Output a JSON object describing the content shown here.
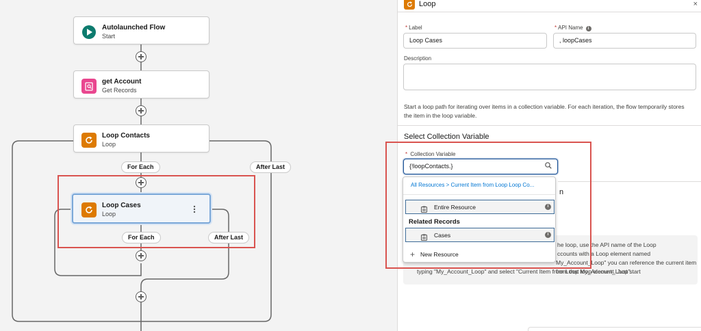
{
  "canvas": {
    "nodes": [
      {
        "title": "Autolaunched Flow",
        "subtitle": "Start"
      },
      {
        "title": "get Account",
        "subtitle": "Get Records"
      },
      {
        "title": "Loop Contacts",
        "subtitle": "Loop"
      },
      {
        "title": "Loop Cases",
        "subtitle": "Loop"
      }
    ],
    "outer_for_each": "For Each",
    "outer_after_last": "After Last",
    "inner_for_each": "For Each",
    "inner_after_last": "After Last"
  },
  "panel": {
    "title": "Loop",
    "close_glyph": "×",
    "label_field": {
      "label": "Label",
      "value": "Loop Cases"
    },
    "api_name_field": {
      "label": "API Name",
      "value": ", loopCases"
    },
    "description_field": {
      "label": "Description",
      "value": ""
    },
    "intro_text": "Start a loop path for iterating over items in a collection variable. For each iteration, the flow temporarily stores the item in the loop variable.",
    "section_title": "Select Collection Variable",
    "collection_field": {
      "label": "Collection Variable",
      "value": "{!loopContacts.}"
    },
    "hidden_heading_fragment": "n",
    "info_line1": "he loop, use the API name of the Loop",
    "info_line2": "ccounts with a Loop element named",
    "info_line3": "My_Account_Loop\" you can reference the current item from that loop element. Just start",
    "info_line4": "typing \"My_Account_Loop\" and select \"Current Item from Loop My_Account_Loop\"."
  },
  "dropdown": {
    "breadcrumb": "All Resources > Current Item from Loop Loop Co...",
    "items": [
      {
        "label": "Entire Resource"
      },
      {
        "label": "Cases"
      }
    ],
    "related_heading": "Related Records",
    "new_resource": "New Resource"
  },
  "colors": {
    "start_icon": "#0d7b6e",
    "get_records_icon": "#e9478f",
    "loop_icon": "#dd7a01",
    "highlight": "#d9534f",
    "link": "#0176d3"
  }
}
